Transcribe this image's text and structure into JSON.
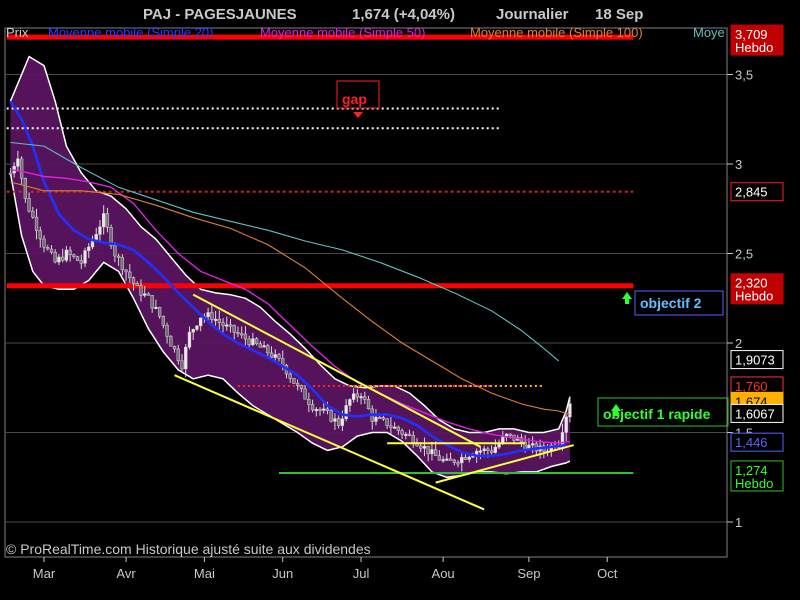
{
  "header": {
    "symbol_title": "PAJ - PAGESJAUNES",
    "quote": "1,674 (+4,04%)",
    "period": "Journalier",
    "date": "18 Sep"
  },
  "legend": {
    "price_label": "Prix",
    "ma20_label": "Moyenne mobile (Simple 20)",
    "ma50_label": "Moyenne mobile (Simple 50)",
    "ma100_label": "Moyenne mobile (Simple 100)",
    "more_label": "Moye"
  },
  "colors": {
    "background": "#000000",
    "plot_bg": "#000000",
    "price_fill": "#5a1460",
    "bollinger_edge": "#ffffff",
    "ma20": "#2030ff",
    "ma50": "#e020e0",
    "ma100": "#e08030",
    "ma200": "#60c0c0",
    "resistance_red": "#ff0000",
    "trend_yellow": "#ffff40",
    "support_green": "#30c030",
    "grid": "#4a4a4a"
  },
  "footer": {
    "copyright": "© ProRealTime.com Historique ajusté suite aux dividendes"
  },
  "annotations": {
    "gap_label": "gap",
    "objectif2_label": "objectif 2",
    "objectif1_label": "objectif 1 rapide"
  },
  "price_tags": [
    {
      "value": "3,709",
      "sub": "Hebdo",
      "bg": "#c00000",
      "fg": "#ffffff",
      "y": 3.709
    },
    {
      "value": "2,845",
      "sub": "",
      "bg": "#000000",
      "fg": "#ffffff",
      "border": "#ff2020",
      "y": 2.845
    },
    {
      "value": "2,320",
      "sub": "Hebdo",
      "bg": "#c00000",
      "fg": "#ffffff",
      "y": 2.32
    },
    {
      "value": "1,9073",
      "sub": "",
      "bg": "#000000",
      "fg": "#ffffff",
      "border": "#ffffff",
      "y": 1.9073
    },
    {
      "value": "1,760",
      "sub": "",
      "bg": "#000000",
      "fg": "#ff3030",
      "border": "#ff3030",
      "y": 1.76
    },
    {
      "value": "1,674",
      "sub": "",
      "bg": "#ffb000",
      "fg": "#000000",
      "y": 1.674
    },
    {
      "value": "1,6067",
      "sub": "",
      "bg": "#000000",
      "fg": "#ffffff",
      "border": "#ffffff",
      "y": 1.6067
    },
    {
      "value": "1,446",
      "sub": "",
      "bg": "#000000",
      "fg": "#6060ff",
      "border": "#6060ff",
      "y": 1.446
    },
    {
      "value": "1,274",
      "sub": "Hebdo",
      "bg": "#000000",
      "fg": "#30ff30",
      "border": "#30c030",
      "y": 1.274
    }
  ],
  "chart_data": {
    "type": "line",
    "title": "PAJ - PAGESJAUNES",
    "xlabel": "",
    "ylabel": "",
    "x_ticks": [
      "Mar",
      "Avr",
      "Mai",
      "Jun",
      "Jul",
      "Aou",
      "Sep",
      "Oct"
    ],
    "y_ticks": [
      "1",
      "1,5",
      "2",
      "2,5",
      "3",
      "3,5"
    ],
    "y_tick_values": [
      1,
      1.5,
      2,
      2.5,
      3,
      3.5
    ],
    "ylim": [
      0.97,
      3.78
    ],
    "grid": true,
    "x_day_index": {
      "Mar": 0,
      "Avr": 22,
      "Mai": 43,
      "Jun": 64,
      "Jul": 85,
      "Aou": 107,
      "Sep": 130,
      "Oct": 151
    },
    "x_last_index": 158,
    "series": [
      {
        "name": "Prix",
        "kind": "close",
        "points": [
          [
            -9,
            2.95
          ],
          [
            -7,
            3.05
          ],
          [
            -5,
            2.8
          ],
          [
            -3,
            2.7
          ],
          [
            0,
            2.55
          ],
          [
            3,
            2.45
          ],
          [
            6,
            2.5
          ],
          [
            10,
            2.45
          ],
          [
            13,
            2.58
          ],
          [
            16,
            2.7
          ],
          [
            19,
            2.5
          ],
          [
            22,
            2.4
          ],
          [
            25,
            2.3
          ],
          [
            28,
            2.25
          ],
          [
            31,
            2.15
          ],
          [
            34,
            2.0
          ],
          [
            37,
            1.88
          ],
          [
            39,
            2.05
          ],
          [
            42,
            2.15
          ],
          [
            45,
            2.15
          ],
          [
            48,
            2.1
          ],
          [
            52,
            2.05
          ],
          [
            56,
            2.0
          ],
          [
            60,
            1.95
          ],
          [
            64,
            1.88
          ],
          [
            68,
            1.75
          ],
          [
            72,
            1.65
          ],
          [
            76,
            1.6
          ],
          [
            79,
            1.55
          ],
          [
            82,
            1.68
          ],
          [
            85,
            1.72
          ],
          [
            88,
            1.58
          ],
          [
            92,
            1.55
          ],
          [
            96,
            1.5
          ],
          [
            100,
            1.45
          ],
          [
            104,
            1.38
          ],
          [
            108,
            1.33
          ],
          [
            112,
            1.36
          ],
          [
            116,
            1.4
          ],
          [
            120,
            1.4
          ],
          [
            124,
            1.48
          ],
          [
            127,
            1.46
          ],
          [
            130,
            1.42
          ],
          [
            134,
            1.4
          ],
          [
            138,
            1.45
          ],
          [
            140,
            1.6
          ],
          [
            141,
            1.674
          ]
        ]
      },
      {
        "name": "Moyenne mobile (Simple 20)",
        "kind": "ma20",
        "points": [
          [
            -9,
            3.35
          ],
          [
            -6,
            3.25
          ],
          [
            -3,
            3.1
          ],
          [
            0,
            2.9
          ],
          [
            4,
            2.72
          ],
          [
            8,
            2.63
          ],
          [
            12,
            2.58
          ],
          [
            16,
            2.56
          ],
          [
            20,
            2.55
          ],
          [
            24,
            2.52
          ],
          [
            28,
            2.45
          ],
          [
            32,
            2.37
          ],
          [
            36,
            2.28
          ],
          [
            40,
            2.2
          ],
          [
            44,
            2.12
          ],
          [
            48,
            2.05
          ],
          [
            52,
            2.0
          ],
          [
            56,
            1.96
          ],
          [
            60,
            1.92
          ],
          [
            64,
            1.87
          ],
          [
            68,
            1.82
          ],
          [
            72,
            1.74
          ],
          [
            76,
            1.65
          ],
          [
            80,
            1.6
          ],
          [
            84,
            1.59
          ],
          [
            88,
            1.6
          ],
          [
            92,
            1.6
          ],
          [
            96,
            1.58
          ],
          [
            100,
            1.54
          ],
          [
            104,
            1.48
          ],
          [
            108,
            1.43
          ],
          [
            112,
            1.39
          ],
          [
            116,
            1.37
          ],
          [
            120,
            1.37
          ],
          [
            124,
            1.38
          ],
          [
            128,
            1.4
          ],
          [
            132,
            1.41
          ],
          [
            136,
            1.42
          ],
          [
            140,
            1.43
          ]
        ]
      },
      {
        "name": "Moyenne mobile (Simple 50)",
        "kind": "ma50",
        "points": [
          [
            -9,
            2.97
          ],
          [
            -4,
            2.95
          ],
          [
            0,
            2.93
          ],
          [
            6,
            2.92
          ],
          [
            12,
            2.9
          ],
          [
            18,
            2.87
          ],
          [
            24,
            2.78
          ],
          [
            30,
            2.63
          ],
          [
            36,
            2.5
          ],
          [
            42,
            2.4
          ],
          [
            48,
            2.35
          ],
          [
            54,
            2.3
          ],
          [
            60,
            2.22
          ],
          [
            66,
            2.1
          ],
          [
            72,
            1.98
          ],
          [
            78,
            1.87
          ],
          [
            84,
            1.78
          ],
          [
            90,
            1.72
          ],
          [
            96,
            1.66
          ],
          [
            102,
            1.61
          ],
          [
            108,
            1.56
          ],
          [
            114,
            1.52
          ],
          [
            120,
            1.49
          ],
          [
            126,
            1.47
          ],
          [
            132,
            1.45
          ],
          [
            138,
            1.44
          ],
          [
            141,
            1.45
          ]
        ]
      },
      {
        "name": "Moyenne mobile (Simple 100)",
        "kind": "ma100",
        "points": [
          [
            -9,
            2.9
          ],
          [
            0,
            2.85
          ],
          [
            10,
            2.85
          ],
          [
            20,
            2.83
          ],
          [
            30,
            2.77
          ],
          [
            40,
            2.7
          ],
          [
            50,
            2.64
          ],
          [
            60,
            2.55
          ],
          [
            70,
            2.42
          ],
          [
            80,
            2.25
          ],
          [
            88,
            2.12
          ],
          [
            96,
            2.0
          ],
          [
            104,
            1.9
          ],
          [
            112,
            1.8
          ],
          [
            120,
            1.72
          ],
          [
            128,
            1.66
          ],
          [
            134,
            1.63
          ],
          [
            138,
            1.62
          ],
          [
            141,
            1.6
          ]
        ]
      },
      {
        "name": "Moye",
        "kind": "ma200",
        "points": [
          [
            -9,
            3.12
          ],
          [
            0,
            3.1
          ],
          [
            10,
            2.98
          ],
          [
            20,
            2.87
          ],
          [
            30,
            2.8
          ],
          [
            40,
            2.73
          ],
          [
            50,
            2.68
          ],
          [
            60,
            2.63
          ],
          [
            70,
            2.57
          ],
          [
            80,
            2.52
          ],
          [
            90,
            2.45
          ],
          [
            100,
            2.37
          ],
          [
            110,
            2.28
          ],
          [
            120,
            2.18
          ],
          [
            128,
            2.07
          ],
          [
            134,
            1.97
          ],
          [
            138,
            1.9
          ]
        ]
      }
    ],
    "bollinger": {
      "upper": [
        [
          -9,
          3.35
        ],
        [
          -4,
          3.6
        ],
        [
          0,
          3.55
        ],
        [
          3,
          3.35
        ],
        [
          6,
          3.1
        ],
        [
          10,
          2.95
        ],
        [
          14,
          2.85
        ],
        [
          18,
          2.82
        ],
        [
          22,
          2.75
        ],
        [
          26,
          2.65
        ],
        [
          30,
          2.58
        ],
        [
          34,
          2.48
        ],
        [
          38,
          2.38
        ],
        [
          42,
          2.3
        ],
        [
          46,
          2.28
        ],
        [
          50,
          2.27
        ],
        [
          54,
          2.25
        ],
        [
          58,
          2.2
        ],
        [
          62,
          2.12
        ],
        [
          66,
          2.05
        ],
        [
          70,
          1.97
        ],
        [
          74,
          1.88
        ],
        [
          78,
          1.8
        ],
        [
          82,
          1.76
        ],
        [
          86,
          1.75
        ],
        [
          90,
          1.76
        ],
        [
          94,
          1.76
        ],
        [
          98,
          1.72
        ],
        [
          102,
          1.65
        ],
        [
          106,
          1.57
        ],
        [
          110,
          1.52
        ],
        [
          114,
          1.5
        ],
        [
          118,
          1.5
        ],
        [
          122,
          1.52
        ],
        [
          126,
          1.52
        ],
        [
          130,
          1.5
        ],
        [
          134,
          1.5
        ],
        [
          138,
          1.52
        ],
        [
          140,
          1.62
        ],
        [
          141,
          1.7
        ]
      ],
      "lower": [
        [
          -9,
          2.95
        ],
        [
          -6,
          2.6
        ],
        [
          -3,
          2.4
        ],
        [
          0,
          2.32
        ],
        [
          4,
          2.3
        ],
        [
          8,
          2.3
        ],
        [
          12,
          2.35
        ],
        [
          16,
          2.45
        ],
        [
          20,
          2.4
        ],
        [
          24,
          2.25
        ],
        [
          28,
          2.08
        ],
        [
          32,
          1.95
        ],
        [
          36,
          1.85
        ],
        [
          40,
          1.8
        ],
        [
          44,
          1.82
        ],
        [
          48,
          1.8
        ],
        [
          52,
          1.72
        ],
        [
          56,
          1.65
        ],
        [
          60,
          1.6
        ],
        [
          64,
          1.55
        ],
        [
          68,
          1.5
        ],
        [
          72,
          1.44
        ],
        [
          76,
          1.4
        ],
        [
          80,
          1.42
        ],
        [
          84,
          1.48
        ],
        [
          88,
          1.5
        ],
        [
          92,
          1.5
        ],
        [
          96,
          1.45
        ],
        [
          100,
          1.37
        ],
        [
          104,
          1.28
        ],
        [
          108,
          1.25
        ],
        [
          112,
          1.26
        ],
        [
          116,
          1.28
        ],
        [
          120,
          1.28
        ],
        [
          124,
          1.27
        ],
        [
          128,
          1.28
        ],
        [
          132,
          1.28
        ],
        [
          136,
          1.31
        ],
        [
          140,
          1.33
        ],
        [
          141,
          1.34
        ]
      ]
    },
    "horizontal_lines": [
      {
        "name": "resistance-3709",
        "y": 3.709,
        "x0": -10,
        "x1": 158,
        "color": "#ff0000",
        "width": 5,
        "dash": ""
      },
      {
        "name": "gap-upper",
        "y": 3.31,
        "x0": -10,
        "x1": 122,
        "color": "#ffffff",
        "width": 2,
        "dash": "2,3"
      },
      {
        "name": "gap-lower",
        "y": 3.2,
        "x0": -10,
        "x1": 122,
        "color": "#ffffff",
        "width": 2,
        "dash": "2,3"
      },
      {
        "name": "level-2845",
        "y": 2.845,
        "x0": -10,
        "x1": 158,
        "color": "#d02020",
        "width": 2,
        "dash": "3,3"
      },
      {
        "name": "resistance-2320",
        "y": 2.32,
        "x0": -10,
        "x1": 158,
        "color": "#ff0000",
        "width": 5,
        "dash": ""
      },
      {
        "name": "level-1760-red",
        "y": 1.76,
        "x0": 52,
        "x1": 120,
        "color": "#ff2020",
        "width": 2,
        "dash": "2,3"
      },
      {
        "name": "level-1760-yellow",
        "y": 1.76,
        "x0": 82,
        "x1": 134,
        "color": "#ffb000",
        "width": 2,
        "dash": "2,3"
      },
      {
        "name": "support-1274",
        "y": 1.274,
        "x0": 63,
        "x1": 158,
        "color": "#30c030",
        "width": 2,
        "dash": ""
      }
    ],
    "trend_lines": [
      {
        "name": "trend-lower",
        "x0": 35,
        "y0": 1.82,
        "x1": 118,
        "y1": 1.07,
        "color": "#ffff40"
      },
      {
        "name": "trend-upper",
        "x0": 40,
        "y0": 2.27,
        "x1": 117,
        "y1": 1.42,
        "color": "#ffff40"
      },
      {
        "name": "trend-support-up",
        "x0": 105,
        "y0": 1.22,
        "x1": 142,
        "y1": 1.43,
        "color": "#ffff40"
      },
      {
        "name": "flat-top",
        "x0": 92,
        "y0": 1.44,
        "x1": 129,
        "y1": 1.44,
        "color": "#ffff40"
      }
    ]
  }
}
